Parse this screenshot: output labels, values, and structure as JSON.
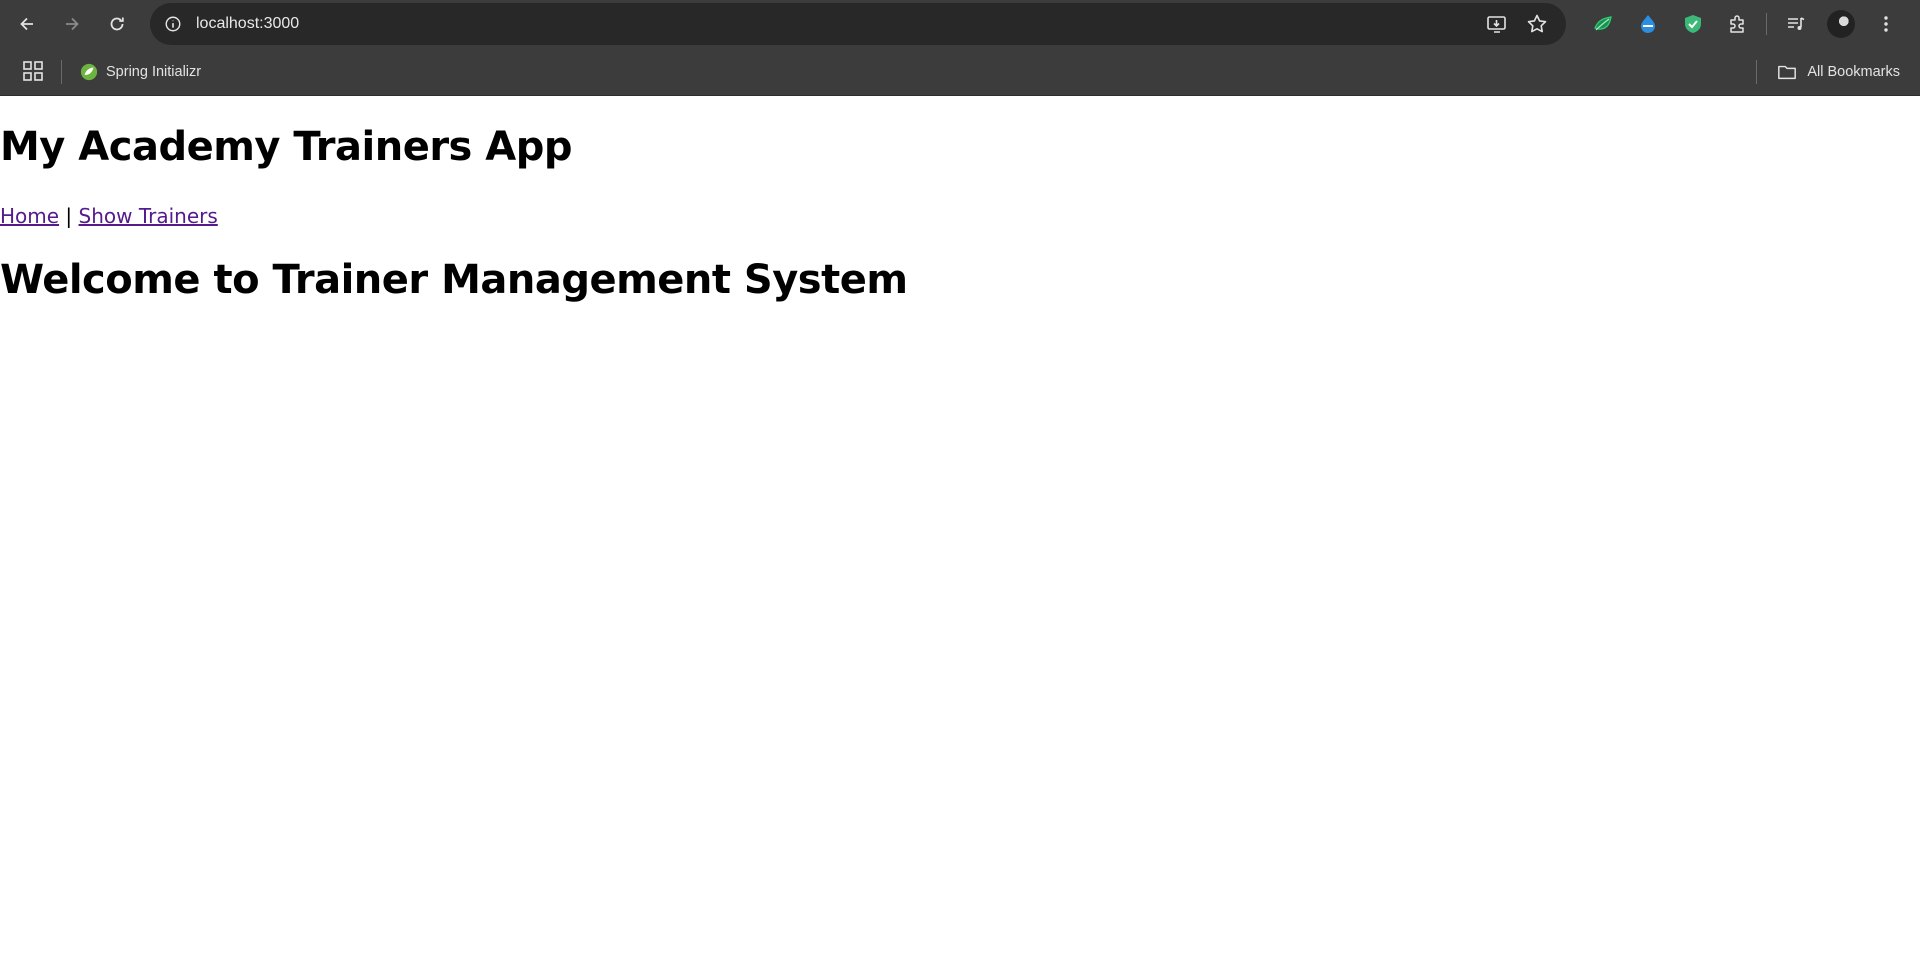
{
  "browser": {
    "url": "localhost:3000",
    "bookmarks": {
      "items": [
        {
          "label": "Spring Initializr"
        }
      ],
      "all_bookmarks_label": "All Bookmarks"
    },
    "icons": {
      "back": "back-arrow-icon",
      "forward": "forward-arrow-icon",
      "reload": "reload-icon",
      "site_info": "info-icon",
      "install": "install-app-icon",
      "bookmark_star": "star-icon",
      "extensions": [
        "leaf-extension-icon",
        "blue-extension-icon",
        "shield-extension-icon",
        "puzzle-icon"
      ],
      "media": "media-queue-icon",
      "profile": "avatar",
      "menu": "kebab-menu-icon"
    }
  },
  "page": {
    "app_title": "My Academy Trainers App",
    "nav": {
      "home": "Home",
      "separator": "|",
      "show_trainers": "Show Trainers"
    },
    "welcome_heading": "Welcome to Trainer Management System"
  },
  "colors": {
    "chrome_bg": "#3c3c3c",
    "omnibox_bg": "#282828",
    "visited_link": "#551a8b"
  }
}
